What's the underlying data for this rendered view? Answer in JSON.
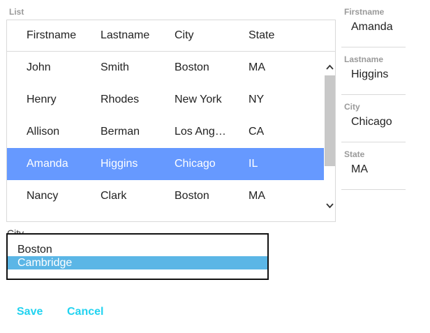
{
  "list": {
    "label": "List",
    "columns": [
      "Firstname",
      "Lastname",
      "City",
      "State"
    ],
    "rows": [
      {
        "firstname": "John",
        "lastname": "Smith",
        "city": "Boston",
        "state": "MA"
      },
      {
        "firstname": "Henry",
        "lastname": "Rhodes",
        "city": "New York",
        "state": "NY"
      },
      {
        "firstname": "Allison",
        "lastname": "Berman",
        "city": "Los Ang…",
        "state": "CA"
      },
      {
        "firstname": "Amanda",
        "lastname": "Higgins",
        "city": "Chicago",
        "state": "IL"
      },
      {
        "firstname": "Nancy",
        "lastname": "Clark",
        "city": "Boston",
        "state": "MA"
      }
    ],
    "selected_row": 3
  },
  "detail": {
    "firstname_label": "Firstname",
    "firstname_value": "Amanda",
    "lastname_label": "Lastname",
    "lastname_value": "Higgins",
    "city_label": "City",
    "city_value": "Chicago",
    "state_label": "State",
    "state_value": "MA"
  },
  "city_select": {
    "label": "City",
    "options": [
      "Boston",
      "Cambridge"
    ],
    "selected": 1
  },
  "actions": {
    "save_label": "Save",
    "cancel_label": "Cancel"
  },
  "colors": {
    "selected_row": "#6699ff",
    "selected_option": "#5bb6e6",
    "action_text": "#22d3f0"
  },
  "icons": {
    "scroll_up": "chevron-up-icon",
    "scroll_down": "chevron-down-icon"
  }
}
